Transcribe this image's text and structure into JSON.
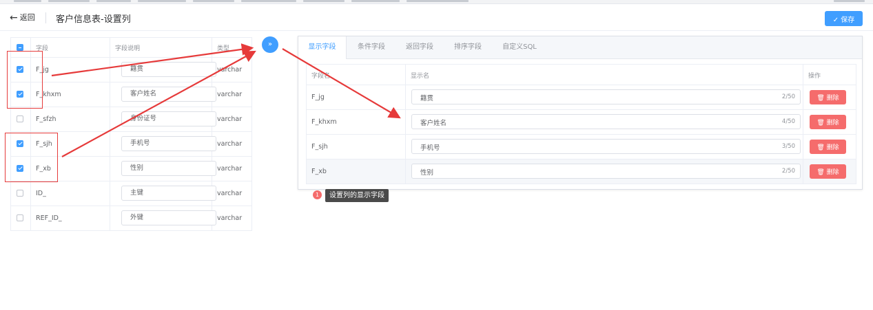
{
  "header": {
    "back_label": "返回",
    "title": "客户信息表-设置列",
    "save_label": "✓ 保存"
  },
  "source_table": {
    "columns": [
      "字段",
      "字段说明",
      "类型"
    ],
    "rows": [
      {
        "field": "F_jg",
        "desc": "籍贯",
        "type": "varchar",
        "checked": true
      },
      {
        "field": "F_khxm",
        "desc": "客户姓名",
        "type": "varchar",
        "checked": true
      },
      {
        "field": "F_sfzh",
        "desc": "身份证号",
        "type": "varchar",
        "checked": false
      },
      {
        "field": "F_sjh",
        "desc": "手机号",
        "type": "varchar",
        "checked": true
      },
      {
        "field": "F_xb",
        "desc": "性别",
        "type": "varchar",
        "checked": true
      },
      {
        "field": "ID_",
        "desc": "主键",
        "type": "varchar",
        "checked": false
      },
      {
        "field": "REF_ID_",
        "desc": "外键",
        "type": "varchar",
        "checked": false
      }
    ]
  },
  "transfer_icon": "»",
  "tabs": [
    {
      "label": "显示字段",
      "active": true
    },
    {
      "label": "条件字段",
      "active": false
    },
    {
      "label": "返回字段",
      "active": false
    },
    {
      "label": "排序字段",
      "active": false
    },
    {
      "label": "自定义SQL",
      "active": false
    }
  ],
  "display_table": {
    "columns": [
      "字段名",
      "显示名",
      "操作"
    ],
    "delete_label": "🗑 删除",
    "rows": [
      {
        "field": "F_jg",
        "name": "籍贯",
        "count": "2/50"
      },
      {
        "field": "F_khxm",
        "name": "客户姓名",
        "count": "4/50"
      },
      {
        "field": "F_sjh",
        "name": "手机号",
        "count": "3/50"
      },
      {
        "field": "F_xb",
        "name": "性别",
        "count": "2/50"
      }
    ]
  },
  "annotation": {
    "badge": "1",
    "tooltip": "设置列的显示字段"
  },
  "colors": {
    "primary": "#409eff",
    "danger": "#f56c6c",
    "annotation_red": "#e63a3a"
  }
}
